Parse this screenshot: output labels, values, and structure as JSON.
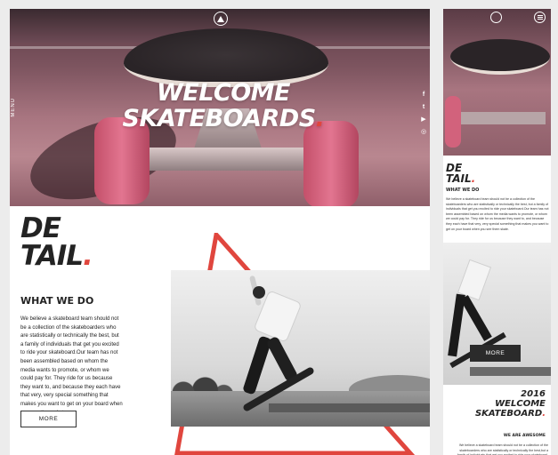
{
  "desktop": {
    "hero": {
      "title_line1": "WELCOME",
      "title_line2": "SKATEBOARDS",
      "title_dot": ".",
      "side_label": "MENU",
      "social": [
        "f",
        "t",
        "▶",
        "◎"
      ]
    },
    "detail": {
      "heading_line1": "DE",
      "heading_line2": "TAIL",
      "heading_dot": ".",
      "subheading": "WHAT WE DO",
      "body": "We believe a skateboard team should not be a collection of the skateboarders who are statistically or technically the best, but a family of individuals that get you excited to ride your skateboard.Our team has not been assembled based on whom the media wants to promote, or whom we could pay for. They ride for us because they want to, and because they each have that very, very special something that makes you want to get on your board when you see them skate.",
      "more_button": "MORE"
    }
  },
  "mobile": {
    "detail": {
      "heading_line1": "DE",
      "heading_line2": "TAIL",
      "heading_dot": ".",
      "subheading": "WHAT WE DO",
      "body": "We believe a skateboard team should not be a collection of the skateboarders who are statistically or technically the best, but a family of individuals that get you excited to ride your skateboard.Our team has not been assembled based on whom the media wants to promote, or whom we could pay for. They ride for us because they want to, and because they each have that very, very special something that makes you want to get on your board when you see them skate.",
      "more_button": "MORE"
    },
    "awesome": {
      "line1": "2016",
      "line2": "WELCOME",
      "line3": "SKATEBOARD",
      "dot": ".",
      "subheading": "WE ARE AWESOME",
      "body": "We believe a skateboard team should not be a collection of the skateboarders who are statistically or technically the best,but a family of individuals that get you excited to ride your skateboard. Our team has not been assembled based on whom the media"
    }
  },
  "colors": {
    "accent": "#e0463e",
    "text": "#232323",
    "hero_tint": "#b98790"
  }
}
